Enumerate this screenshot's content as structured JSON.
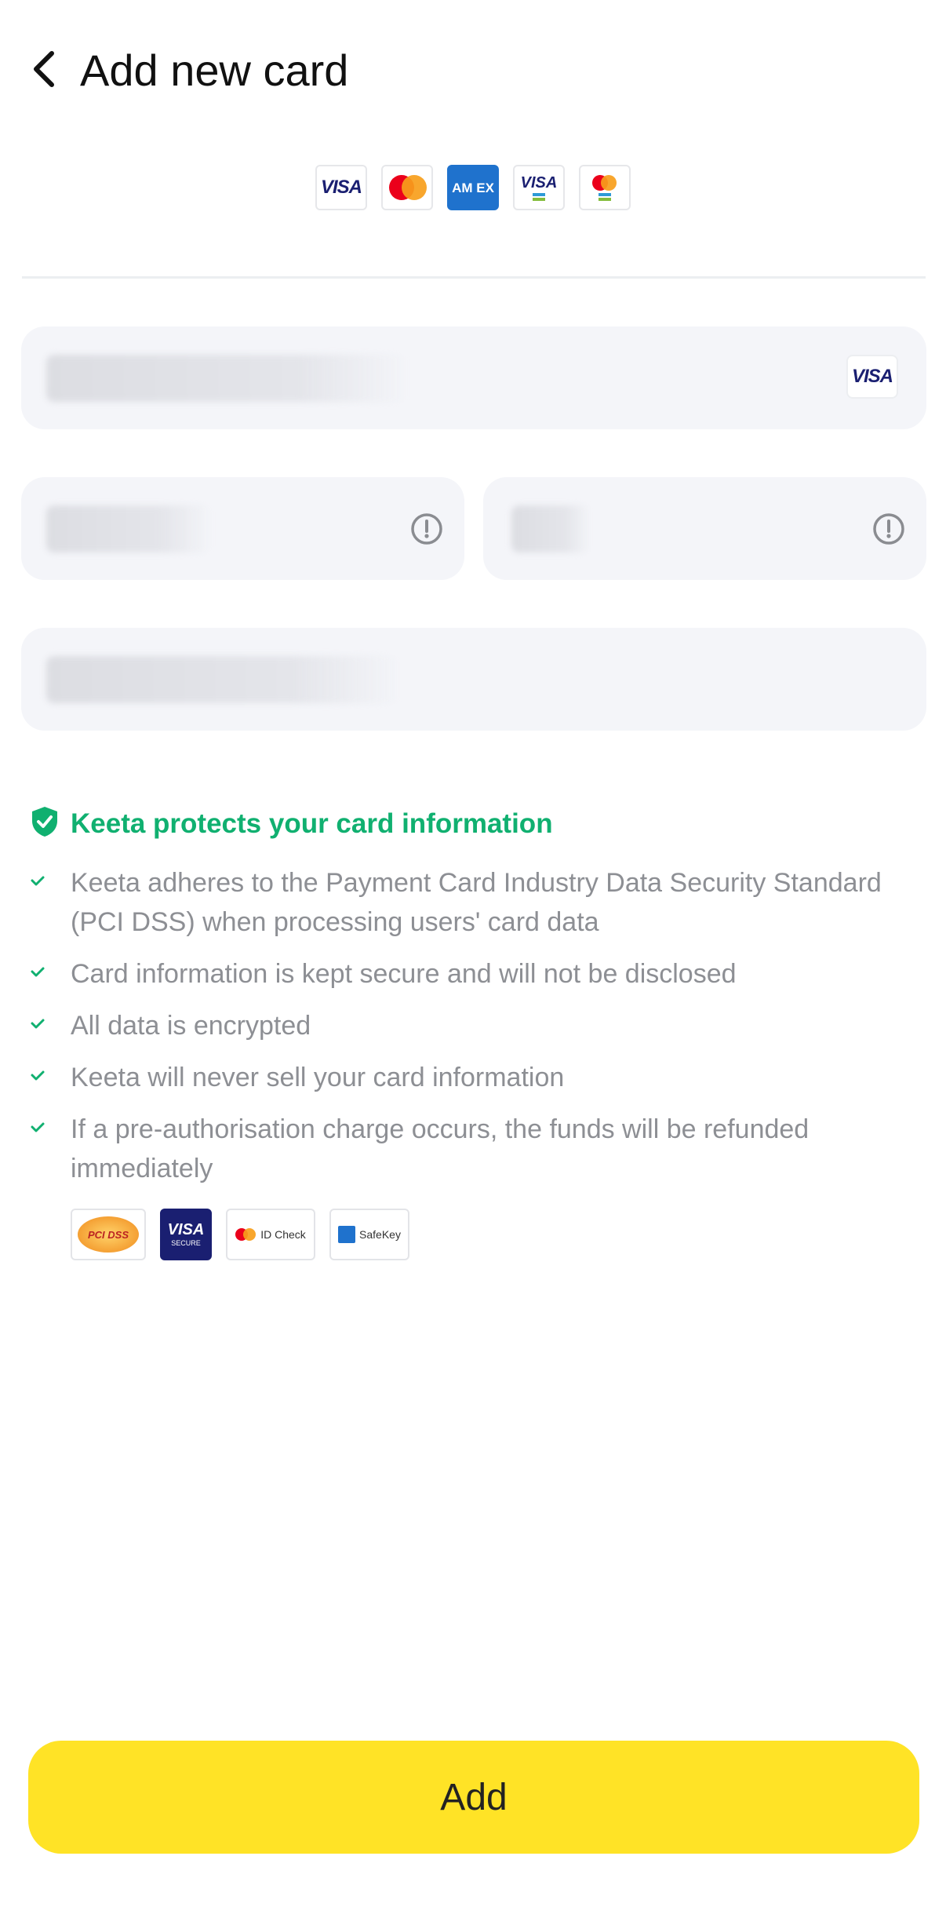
{
  "header": {
    "title": "Add new card"
  },
  "accepted_brands": [
    {
      "name": "visa",
      "label": "VISA"
    },
    {
      "name": "mastercard"
    },
    {
      "name": "amex",
      "label": "AM EX"
    },
    {
      "name": "visa-mada",
      "label": "VISA"
    },
    {
      "name": "mastercard-mada"
    }
  ],
  "form": {
    "card_number_brand": "VISA"
  },
  "protection": {
    "title": "Keeta protects your card information",
    "accent_color": "#10b070",
    "points": [
      "Keeta adheres to the Payment Card Industry Data Security Standard (PCI DSS) when processing users' card data",
      "Card information is kept secure and will not be disclosed",
      "All data is encrypted",
      "Keeta will never sell your card information",
      "If a pre-authorisation charge occurs, the funds will be refunded immediately"
    ]
  },
  "security_badges": {
    "pci": "PCI DSS",
    "visa_secure_top": "VISA",
    "visa_secure_bottom": "SECURE",
    "id_check": "ID Check",
    "safekey": "SafeKey"
  },
  "footer": {
    "add_label": "Add",
    "button_color": "#ffe326"
  }
}
